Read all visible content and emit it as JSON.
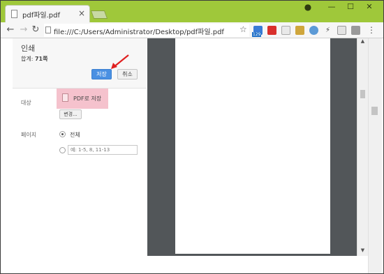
{
  "tab": {
    "title": "pdf파일.pdf",
    "close": "×"
  },
  "window_controls": {
    "profile": "●",
    "minimize": "—",
    "maximize": "☐",
    "close": "✕"
  },
  "toolbar": {
    "back": "←",
    "forward": "→",
    "reload": "↻",
    "url": "file:///C:/Users/Administrator/Desktop/pdf파일.pdf",
    "star": "☆",
    "ext_badge": "129",
    "menu": "⋮"
  },
  "print": {
    "title": "인쇄",
    "total_label": "합계: ",
    "total_value": "71쪽",
    "save_label": "저장",
    "cancel_label": "취소",
    "destination_label": "대상",
    "destination_value": "PDF로 저장",
    "change_label": "변경...",
    "pages_label": "페이지",
    "all_label": "전체",
    "range_placeholder": "예: 1-5, 8, 11-13"
  },
  "scroll": {
    "up": "▲",
    "down": "▼"
  },
  "colors": {
    "title_bar": "#9fc83a",
    "save_button": "#4a90e2",
    "highlight": "#f5c2cd",
    "preview_bg": "#525659",
    "arrow": "#e02020"
  }
}
